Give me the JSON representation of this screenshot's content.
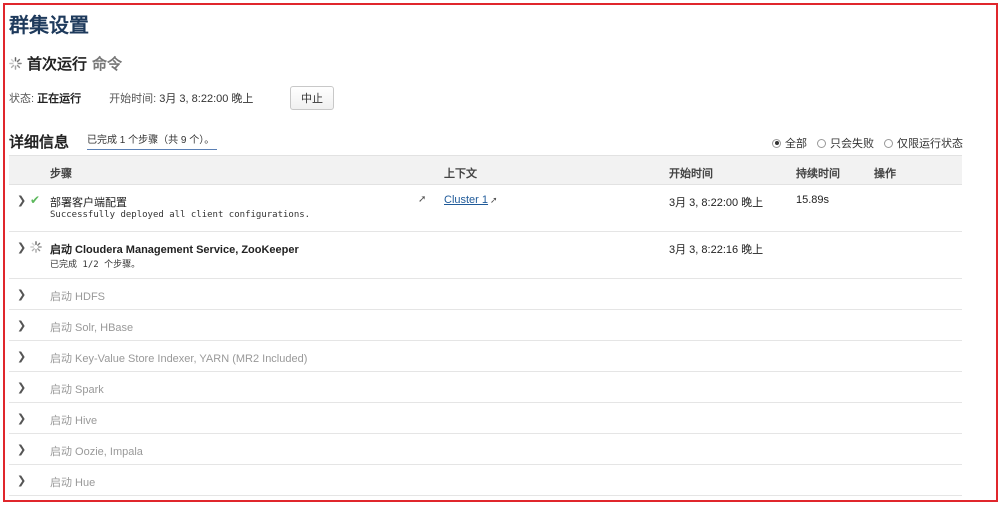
{
  "page": {
    "title": "群集设置"
  },
  "command": {
    "name": "首次运行",
    "suffix": "命令"
  },
  "status": {
    "state_label": "状态:",
    "state_value": "正在运行",
    "start_label": "开始时间:",
    "start_value": "3月 3, 8:22:00 晚上",
    "stop_label": "中止"
  },
  "details": {
    "title": "详细信息",
    "progress": "已完成 1 个步骤（共 9 个）。",
    "filters": [
      {
        "label": "全部",
        "checked": true
      },
      {
        "label": "只会失败",
        "checked": false
      },
      {
        "label": "仅限运行状态",
        "checked": false
      }
    ]
  },
  "table": {
    "headers": {
      "step": "步骤",
      "context": "上下文",
      "start": "开始时间",
      "duration": "持续时间",
      "actions": "操作"
    },
    "rows": [
      {
        "name": "部署客户端配置",
        "desc": "Successfully deployed all client configurations.",
        "context": "Cluster 1",
        "start": "3月 3, 8:22:00 晚上",
        "duration": "15.89s",
        "status_icon": "check-icon"
      },
      {
        "name": "启动 Cloudera Management Service, ZooKeeper",
        "desc": "已完成 1/2 个步骤。",
        "start": "3月 3, 8:22:16 晚上",
        "status_icon": "spinner-icon"
      },
      {
        "name": "启动 HDFS"
      },
      {
        "name": "启动 Solr, HBase"
      },
      {
        "name": "启动 Key-Value Store Indexer, YARN (MR2 Included)"
      },
      {
        "name": "启动 Spark"
      },
      {
        "name": "启动 Hive"
      },
      {
        "name": "启动 Oozie, Impala"
      },
      {
        "name": "启动 Hue"
      }
    ]
  },
  "icons": {
    "expand": "chevron-right-icon",
    "external": "external-link-icon"
  },
  "colors": {
    "frame_border": "#e0262c",
    "title": "#1e3a5c",
    "success": "#5cb85c",
    "link": "#1f5a99"
  }
}
